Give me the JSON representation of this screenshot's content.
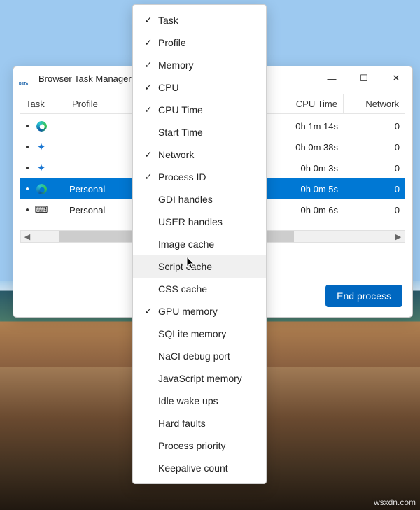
{
  "window": {
    "title": "Browser Task Manager",
    "controls": {
      "minimize": "—",
      "maximize": "☐",
      "close": "✕"
    }
  },
  "columns": {
    "task": "Task",
    "profile": "Profile",
    "cputime": "CPU Time",
    "network": "Network"
  },
  "rows": [
    {
      "icon": "edge",
      "profile": "",
      "cputime": "0h 1m 14s",
      "network": "0",
      "selected": false
    },
    {
      "icon": "puzzle",
      "profile": "",
      "cputime": "0h 0m 38s",
      "network": "0",
      "selected": false
    },
    {
      "icon": "puzzle",
      "profile": "",
      "cputime": "0h 0m 3s",
      "network": "0",
      "selected": false
    },
    {
      "icon": "edge",
      "profile": "Personal",
      "cputime": "0h 0m 5s",
      "network": "0",
      "selected": true
    },
    {
      "icon": "keyboard",
      "profile": "Personal",
      "cputime": "0h 0m 6s",
      "network": "0",
      "selected": false
    }
  ],
  "footer": {
    "end_process": "End process"
  },
  "context_menu": {
    "hovered_index": 11,
    "items": [
      {
        "label": "Task",
        "checked": true
      },
      {
        "label": "Profile",
        "checked": true
      },
      {
        "label": "Memory",
        "checked": true
      },
      {
        "label": "CPU",
        "checked": true
      },
      {
        "label": "CPU Time",
        "checked": true
      },
      {
        "label": "Start Time",
        "checked": false
      },
      {
        "label": "Network",
        "checked": true
      },
      {
        "label": "Process ID",
        "checked": true
      },
      {
        "label": "GDI handles",
        "checked": false
      },
      {
        "label": "USER handles",
        "checked": false
      },
      {
        "label": "Image cache",
        "checked": false
      },
      {
        "label": "Script cache",
        "checked": false
      },
      {
        "label": "CSS cache",
        "checked": false
      },
      {
        "label": "GPU memory",
        "checked": true
      },
      {
        "label": "SQLite memory",
        "checked": false
      },
      {
        "label": "NaCI debug port",
        "checked": false
      },
      {
        "label": "JavaScript memory",
        "checked": false
      },
      {
        "label": "Idle wake ups",
        "checked": false
      },
      {
        "label": "Hard faults",
        "checked": false
      },
      {
        "label": "Process priority",
        "checked": false
      },
      {
        "label": "Keepalive count",
        "checked": false
      }
    ]
  },
  "watermark": "wsxdn.com"
}
